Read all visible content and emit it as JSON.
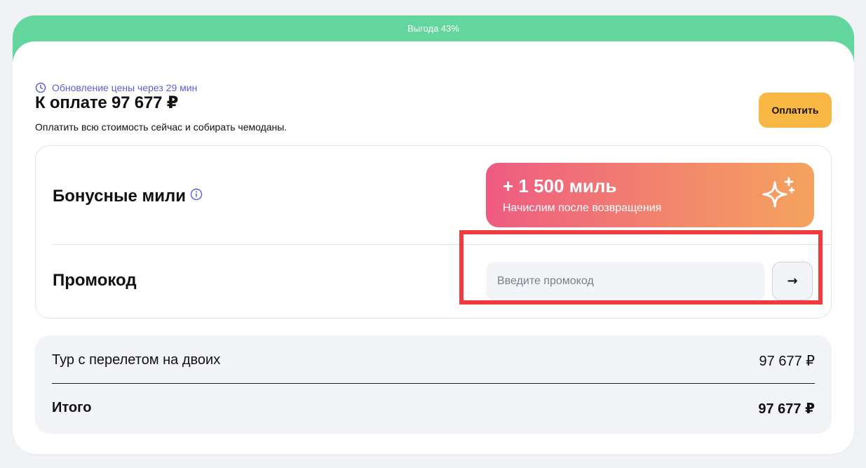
{
  "banner": {
    "text": "Выгода 43%"
  },
  "header": {
    "timer_text": "Обновление цены через 29 мин",
    "title": "К оплате 97 677 ₽",
    "subtitle": "Оплатить всю стоимость сейчас и собирать чемоданы.",
    "pay_button_label": "Оплатить"
  },
  "miles": {
    "label": "Бонусные мили",
    "amount": "+ 1 500 миль",
    "note": "Начислим после возвращения",
    "info_icon": "info-icon",
    "sparkle_icon": "sparkle-icon"
  },
  "promo": {
    "label": "Промокод",
    "placeholder": "Введите промокод",
    "value": "",
    "submit_glyph": "→"
  },
  "summary": {
    "rows": [
      {
        "label": "Тур с перелетом на двоих",
        "value": "97 677 ₽"
      }
    ],
    "total": {
      "label": "Итого",
      "value": "97 677 ₽"
    }
  },
  "colors": {
    "banner_green": "#62d69c",
    "accent_purple": "#5b5fd6",
    "pay_yellow": "#f8b843",
    "miles_gradient_start": "#ee5b82",
    "miles_gradient_end": "#f4a35e",
    "highlight_red": "#ef3b3b"
  }
}
